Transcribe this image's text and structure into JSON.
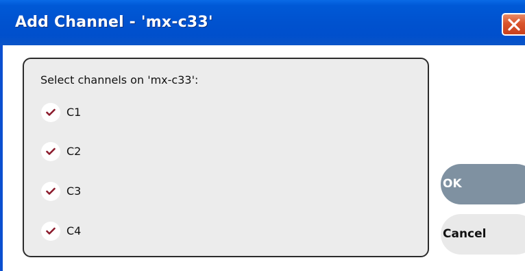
{
  "dialog": {
    "title": "Add Channel - 'mx-c33'",
    "close_icon": "close-icon"
  },
  "group": {
    "label": "Select channels on 'mx-c33':",
    "channels": [
      {
        "label": "C1",
        "checked": true
      },
      {
        "label": "C2",
        "checked": true
      },
      {
        "label": "C3",
        "checked": true
      },
      {
        "label": "C4",
        "checked": true
      }
    ]
  },
  "buttons": {
    "ok_label": "OK",
    "cancel_label": "Cancel"
  },
  "colors": {
    "titlebar": "#0052cf",
    "close_button": "#d9542c",
    "checkmark": "#8b1a2b",
    "ok_button": "#7f91a1",
    "cancel_button": "#e9e9e9"
  }
}
